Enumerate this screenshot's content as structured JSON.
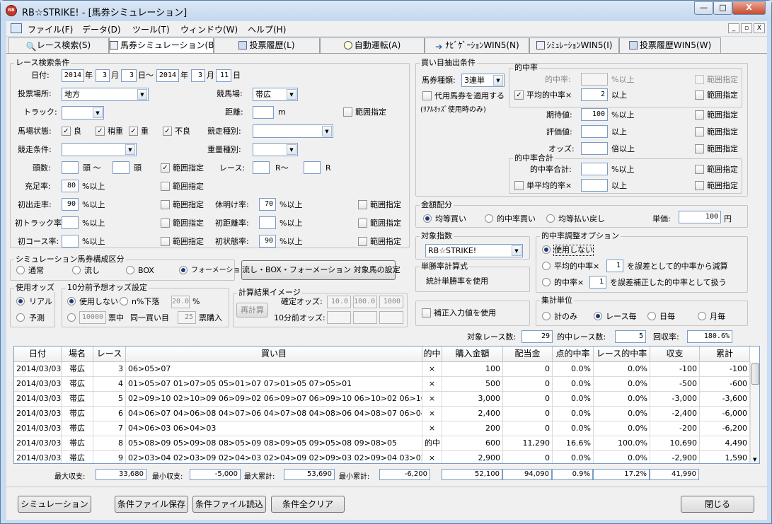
{
  "window": {
    "title": "RB☆STRIKE! - [馬券シミュレーション]",
    "logo": "RB",
    "minimize": "—",
    "maximize": "□",
    "close": "X"
  },
  "menu": {
    "items": [
      "ファイル(F)",
      "データ(D)",
      "ツール(T)",
      "ウィンドウ(W)",
      "ヘルプ(H)"
    ],
    "mdi": [
      "_",
      "▫",
      "X"
    ]
  },
  "tabs": [
    "レース検索(S)",
    "馬券シミュレーション(B)",
    "投票履歴(L)",
    "自動運転(A)",
    "ﾅﾋﾞｹﾞｰｼｮﾝWIN5(N)",
    "ｼﾐｭﾚｰｼｮﾝWIN5(I)",
    "投票履歴WIN5(W)"
  ],
  "race_search": {
    "group_label": "レース検索条件",
    "date_label": "日付:",
    "from_year": "2014",
    "from_month": "3",
    "from_day": "3",
    "to_year": "2014",
    "to_month": "3",
    "to_day": "11",
    "year": "年",
    "month": "月",
    "day_to": "日〜",
    "day": "日",
    "venue_type_label": "投票場所:",
    "venue_type": "地方",
    "track_name_label": "競馬場:",
    "track_name": "帯広",
    "track_label": "トラック:",
    "track": "",
    "distance_label": "距離:",
    "distance": "",
    "distance_unit": "m",
    "range_label": "範囲指定",
    "condition_label": "馬場状態:",
    "conditions": [
      {
        "label": "良",
        "checked": true
      },
      {
        "label": "稍重",
        "checked": true
      },
      {
        "label": "重",
        "checked": true
      },
      {
        "label": "不良",
        "checked": true
      }
    ],
    "race_kind_label": "競走種別:",
    "race_kind": "",
    "race_cond_label": "競走条件:",
    "race_cond": "",
    "weight_kind_label": "重量種別:",
    "weight_kind": "",
    "heads_label": "頭数:",
    "heads_from": "",
    "heads_to": "",
    "heads_unit_from": "頭 〜",
    "heads_unit_to": "頭",
    "heads_range_checked": true,
    "race_label": "レース:",
    "race_from": "",
    "race_to": "",
    "race_r_from": "R〜",
    "race_r_to": "R",
    "fill_rate_label": "充足率:",
    "fill_rate": "80",
    "pct_above": "%以上",
    "first_run_label": "初出走率:",
    "first_run": "90",
    "rest_label": "休明け率:",
    "rest": "70",
    "first_track_label": "初トラック率:",
    "first_track": "",
    "first_dist_label": "初距離率:",
    "first_dist": "",
    "first_course_label": "初コース率:",
    "first_course": "",
    "first_state_label": "初状態率:",
    "first_state": "90"
  },
  "composition": {
    "group_label": "シミュレーション馬券構成区分",
    "options": [
      "通常",
      "流し",
      "BOX",
      "フォーメーション"
    ],
    "selected": 3,
    "button": "流し・BOX・フォーメーション 対象馬の設定"
  },
  "odds_use": {
    "group_label": "使用オッズ",
    "options": [
      "リアル",
      "予測"
    ],
    "selected": 0
  },
  "odds10": {
    "group_label": "10分前予想オッズ設定",
    "unused": "使用しない",
    "drop_label": "n%下落",
    "drop_value": "20.0",
    "pct": "%",
    "yen_value": "10000",
    "yen_label": "票中",
    "same_label": "同一買い目",
    "votes_value": "25",
    "votes_label": "票購入"
  },
  "calc_image": {
    "group_label": "計算結果イメージ",
    "button": "再計算",
    "fixed_label": "確定オッズ:",
    "fixed_values": [
      "10.0",
      "100.0",
      "1000"
    ],
    "ten_label": "10分前オッズ:",
    "ten_values": [
      "",
      "",
      ""
    ]
  },
  "buy_extract": {
    "group_label": "買い目抽出条件",
    "ticket_type_label": "馬券種類:",
    "ticket_type": "3連単",
    "substitute_label": "代用馬券を適用する",
    "substitute_note": "(ﾘｱﾙｵｯｽﾞ使用時のみ)",
    "hit_group": "的中率",
    "hit_rate_label": "的中率:",
    "hit_rate": "",
    "avg_hit_label": "平均的中率×",
    "avg_hit": "2",
    "above": "以上",
    "pct_above": "%以上",
    "expect_label": "期待値:",
    "expect": "100",
    "eval_label": "評価値:",
    "eval": "",
    "odds_label": "オッズ:",
    "odds": "",
    "times_above": "倍以上",
    "range_label": "範囲指定",
    "total_group": "的中率合計",
    "total_label": "的中率合計:",
    "total": "",
    "single_avg_label": "単平均的率×",
    "single_avg": ""
  },
  "allocation": {
    "group_label": "金額配分",
    "options": [
      "均等買い",
      "的中率買い",
      "均等払い戻し"
    ],
    "selected": 0,
    "unit_label": "単価:",
    "unit_value": "100",
    "yen": "円"
  },
  "target": {
    "group_label": "対象指数",
    "value": "RB☆STRIKE!"
  },
  "single_formula": {
    "group_label": "単勝率計算式",
    "value": "統計単勝率を使用"
  },
  "correction": {
    "label": "補正入力値を使用"
  },
  "hit_adjust": {
    "group_label": "的中率調整オプション",
    "opt0": "使用しない",
    "opt1_pre": "平均的中率×",
    "opt1_val": "1",
    "opt1_post": "を誤差として的中率から減算",
    "opt2_pre": "的中率×",
    "opt2_val": "1",
    "opt2_post": "を誤差補正した的中率として扱う",
    "selected": 0
  },
  "aggregate": {
    "group_label": "集計単位",
    "options": [
      "計のみ",
      "レース毎",
      "日毎",
      "月毎"
    ],
    "selected": 1
  },
  "stats": {
    "races_label": "対象レース数:",
    "races": "29",
    "hits_label": "的中レース数:",
    "hits": "5",
    "recovery_label": "回収率:",
    "recovery": "180.6%"
  },
  "grid": {
    "headers": [
      "日付",
      "場名",
      "レース",
      "買い目",
      "的中",
      "購入金額",
      "配当金",
      "点的中率",
      "レース的中率",
      "収支",
      "累計"
    ],
    "rows": [
      [
        "2014/03/03",
        "帯広",
        "3",
        "06>05>07",
        "×",
        "100",
        "0",
        "0.0%",
        "0.0%",
        "-100",
        "-100"
      ],
      [
        "2014/03/03",
        "帯広",
        "4",
        "01>05>07 01>07>05 05>01>07 07>01>05 07>05>01",
        "×",
        "500",
        "0",
        "0.0%",
        "0.0%",
        "-500",
        "-600"
      ],
      [
        "2014/03/03",
        "帯広",
        "5",
        "02>09>10 02>10>09 06>09>02 06>09>07 06>09>10 06>10>02 06>10>09 07>09>10",
        "×",
        "3,000",
        "0",
        "0.0%",
        "0.0%",
        "-3,000",
        "-3,600"
      ],
      [
        "2014/03/03",
        "帯広",
        "6",
        "04>06>07 04>06>08 04>07>06 04>07>08 04>08>06 04>08>07 06>04>07 06>04>08",
        "×",
        "2,400",
        "0",
        "0.0%",
        "0.0%",
        "-2,400",
        "-6,000"
      ],
      [
        "2014/03/03",
        "帯広",
        "7",
        "04>06>03 06>04>03",
        "×",
        "200",
        "0",
        "0.0%",
        "0.0%",
        "-200",
        "-6,200"
      ],
      [
        "2014/03/03",
        "帯広",
        "8",
        "05>08>09 05>09>08 08>05>09 08>09>05 09>05>08 09>08>05",
        "的中",
        "600",
        "11,290",
        "16.6%",
        "100.0%",
        "10,690",
        "4,490"
      ],
      [
        "2014/03/03",
        "帯広",
        "9",
        "02>03>04 02>03>09 02>04>03 02>04>09 02>09>03 02>09>04 03>02>04 03>02>09",
        "×",
        "2,900",
        "0",
        "0.0%",
        "0.0%",
        "-2,900",
        "1,590"
      ]
    ]
  },
  "summary": {
    "max_profit_label": "最大収支:",
    "max_profit": "33,680",
    "min_profit_label": "最小収支:",
    "min_profit": "-5,000",
    "max_total_label": "最大累計:",
    "max_total": "53,690",
    "min_total_label": "最小累計:",
    "min_total": "-6,200",
    "sum_purchase": "52,100",
    "sum_payout": "94,090",
    "sum_point_hit": "0.9%",
    "sum_race_hit": "17.2%",
    "sum_profit": "41,990"
  },
  "footer": {
    "simulate": "シミュレーション",
    "save": "条件ファイル保存",
    "load": "条件ファイル読込",
    "clear": "条件全クリア",
    "close": "閉じる"
  }
}
